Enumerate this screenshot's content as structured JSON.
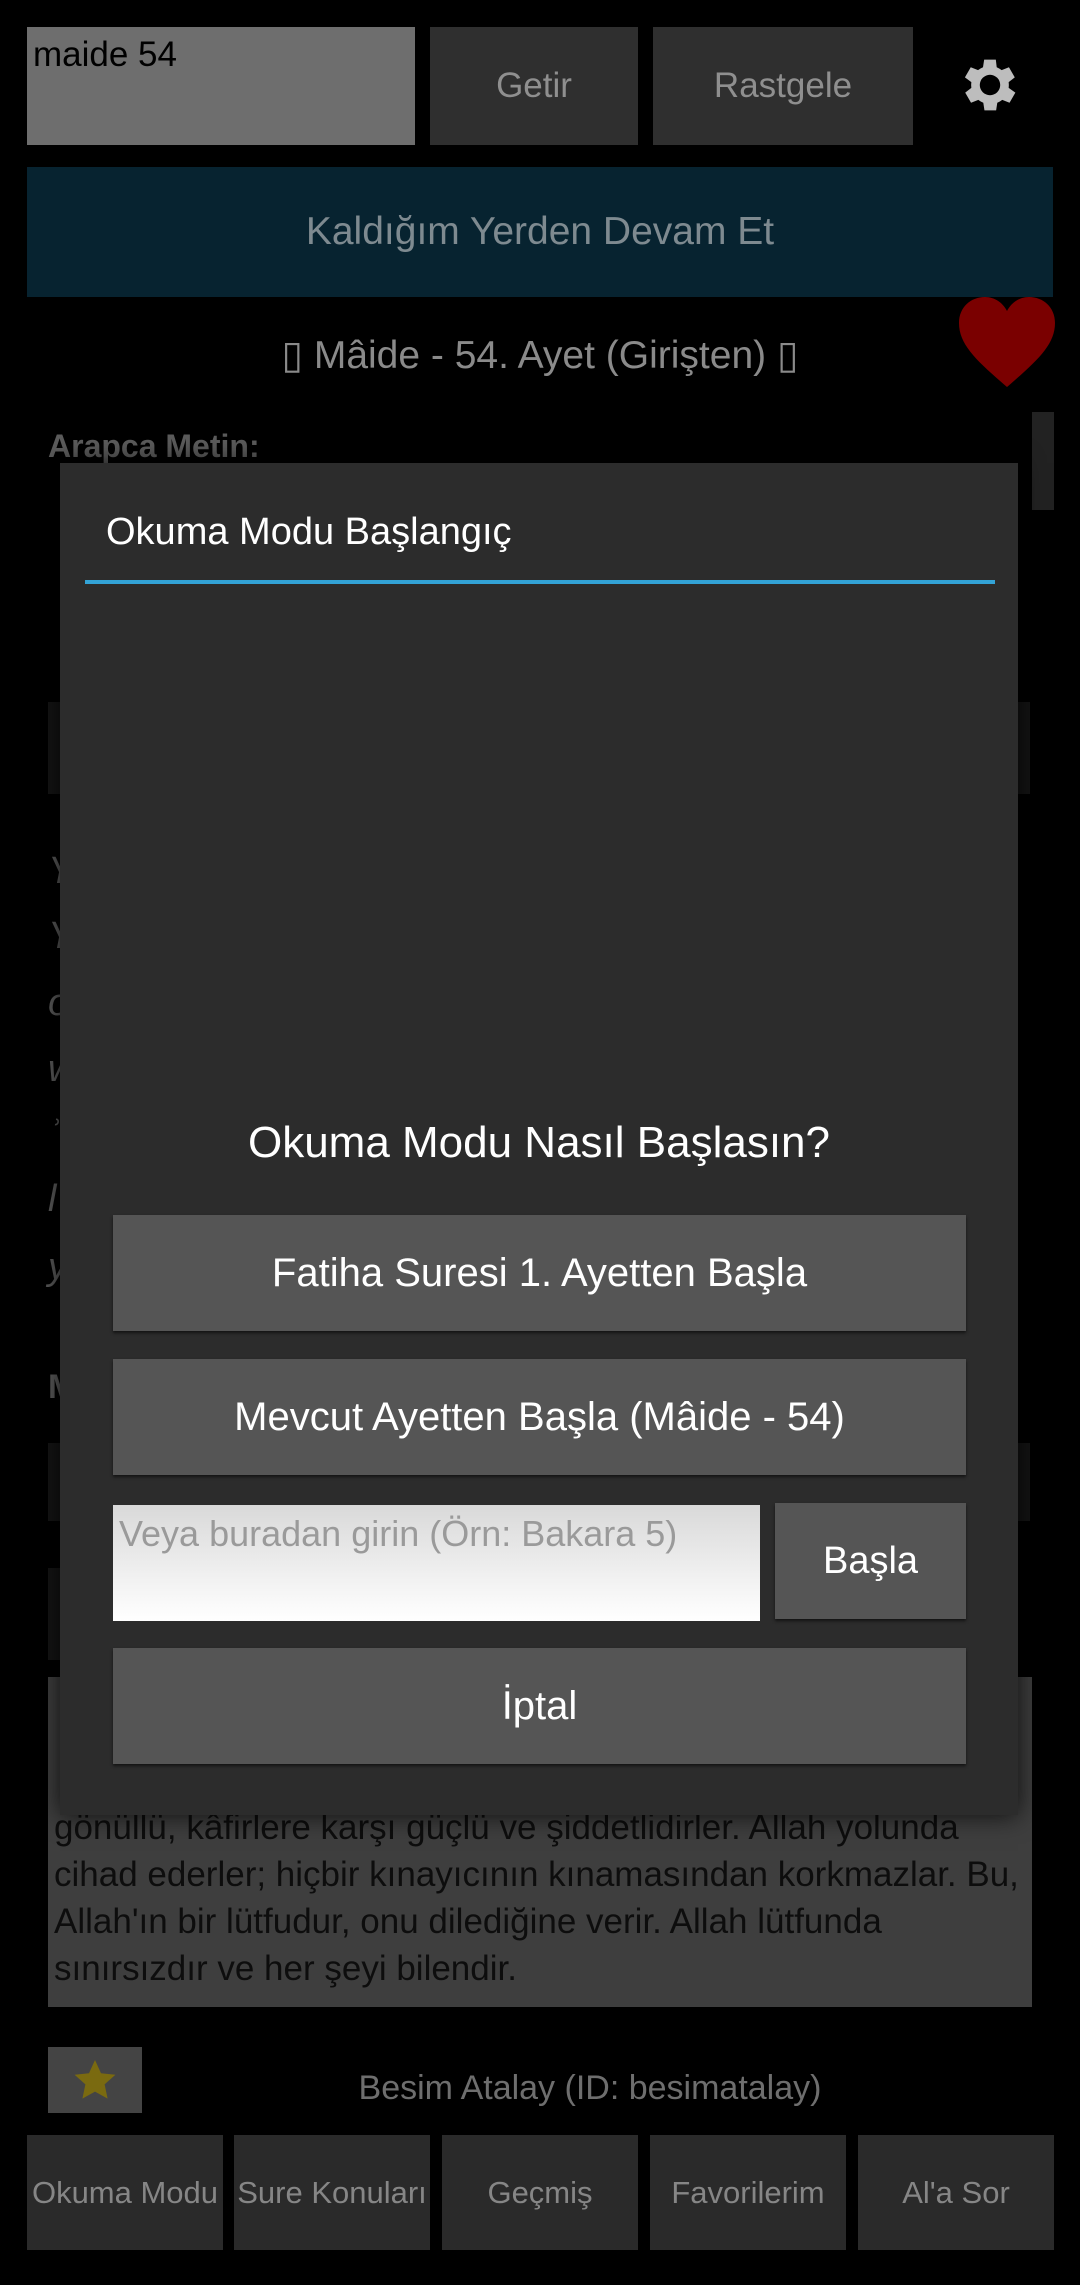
{
  "top_bar": {
    "search_value": "maide 54",
    "getir_label": "Getir",
    "rastgele_label": "Rastgele",
    "settings_icon": "gear-icon"
  },
  "resume_label": "Kaldığım Yerden Devam Et",
  "verse_title": "▯ Mâide - 54. Ayet (Girişten) ▯",
  "favorite_icon": "heart-icon",
  "background": {
    "arabic_label": "Arapca Metin:",
    "transliteration_initials": [
      "Y",
      "Y",
      "o",
      "w",
      "ʾ",
      "l",
      "y"
    ],
    "section_initial": "M",
    "meal_text": "gönüllü, kâfirlere karşı güçlü ve şiddetlidirler. Allah yolunda cihad ederler; hiçbir kınayıcının kınamasından korkmazlar. Bu, Allah'ın bir lütfudur, onu dilediğine verir. Allah lütfunda sınırsızdır ve her şeyi bilendir.",
    "translator": "Besim Atalay (ID: besimatalay)",
    "star_icon": "star-icon"
  },
  "bottom_nav": [
    {
      "label": "Okuma Modu"
    },
    {
      "label": "Sure Konuları"
    },
    {
      "label": "Geçmiş"
    },
    {
      "label": "Favorilerim"
    },
    {
      "label": "Al'a Sor"
    }
  ],
  "dialog": {
    "title": "Okuma Modu Başlangıç",
    "question": "Okuma Modu Nasıl Başlasın?",
    "fatiha_button": "Fatiha Suresi 1. Ayetten Başla",
    "current_button": "Mevcut Ayetten Başla (Mâide - 54)",
    "input_placeholder": "Veya buradan girin (Örn: Bakara 5)",
    "start_button": "Başla",
    "cancel_button": "İptal"
  },
  "colors": {
    "accent_divider": "#33a3d6",
    "heart": "#7a0000",
    "resume_bg": "#072330"
  }
}
